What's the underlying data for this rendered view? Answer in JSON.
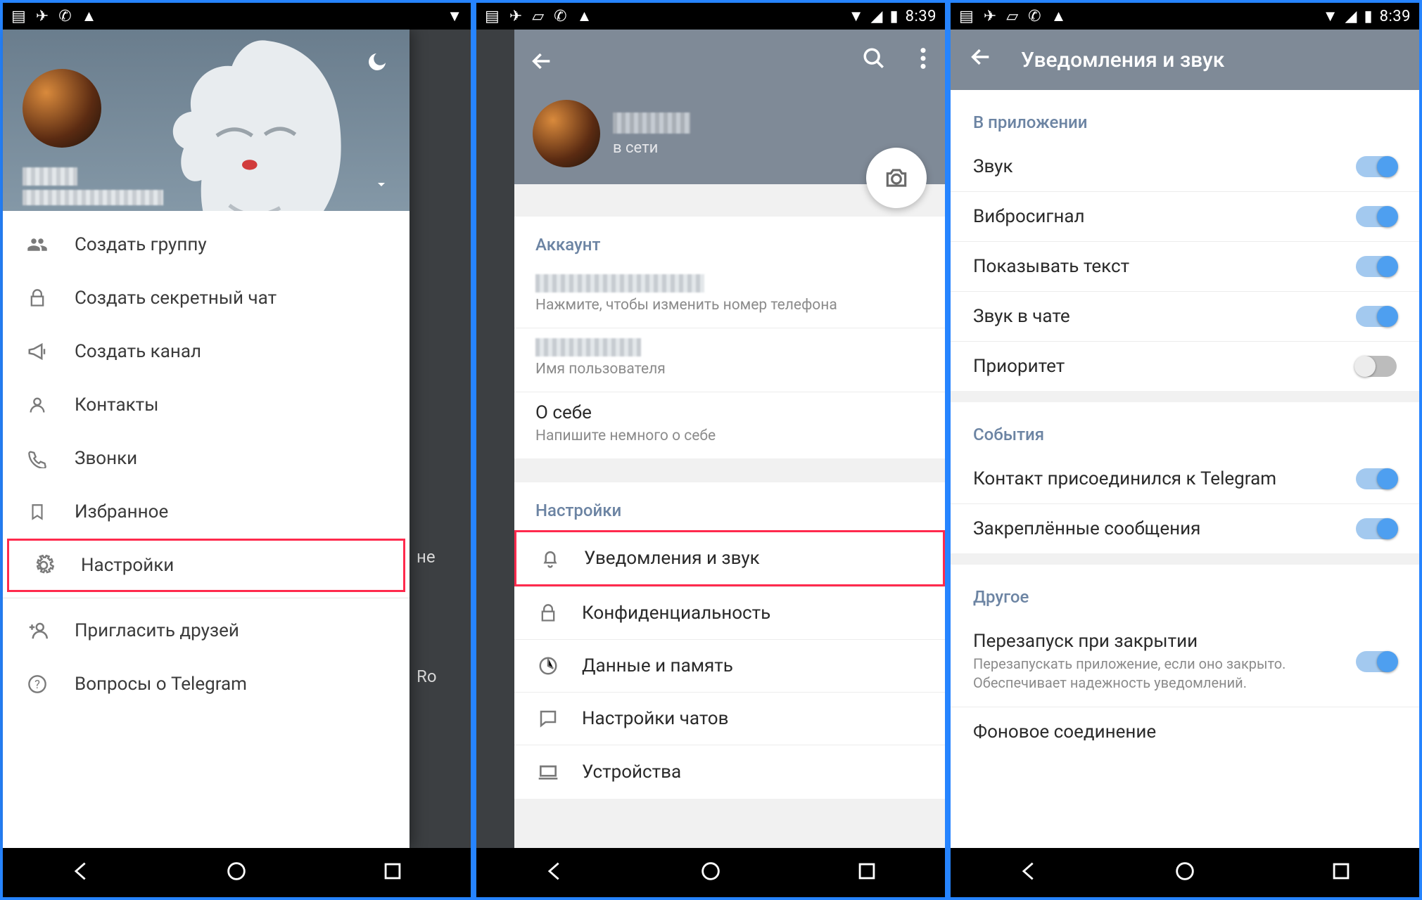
{
  "status": {
    "time": "8:39"
  },
  "phone1": {
    "menu": {
      "create_group": "Создать группу",
      "secret_chat": "Создать секретный чат",
      "create_channel": "Создать канал",
      "contacts": "Контакты",
      "calls": "Звонки",
      "saved": "Избранное",
      "settings": "Настройки",
      "invite": "Пригласить друзей",
      "faq": "Вопросы о Telegram"
    },
    "bg": {
      "ne": "не",
      "ro": "Ro"
    }
  },
  "phone2": {
    "status": "в сети",
    "account_section": "Аккаунт",
    "phone_sub": "Нажмите, чтобы изменить номер телефона",
    "username_sub": "Имя пользователя",
    "about_title": "О себе",
    "about_sub": "Напишите немного о себе",
    "settings_section": "Настройки",
    "rows": {
      "notifications": "Уведомления и звук",
      "privacy": "Конфиденциальность",
      "data": "Данные и память",
      "chat": "Настройки чатов",
      "devices": "Устройства"
    }
  },
  "phone3": {
    "title": "Уведомления и звук",
    "sec_app": "В приложении",
    "app": {
      "sound": "Звук",
      "vibrate": "Вибросигнал",
      "preview": "Показывать текст",
      "chat_sound": "Звук в чате",
      "priority": "Приоритет"
    },
    "sec_events": "События",
    "events": {
      "contact_joined": "Контакт присоединился к Telegram",
      "pinned": "Закреплённые сообщения"
    },
    "sec_other": "Другое",
    "other": {
      "keep_alive": "Перезапуск при закрытии",
      "keep_alive_sub": "Перезапускать приложение, если оно закрыто. Обеспечивает надежность уведомлений.",
      "bg_conn": "Фоновое соединение"
    }
  }
}
